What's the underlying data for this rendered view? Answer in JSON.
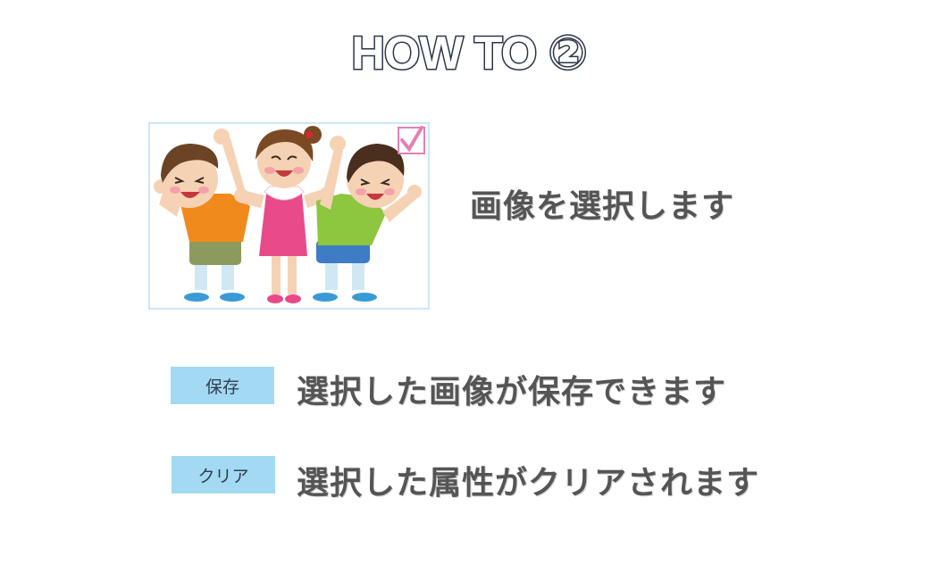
{
  "title": "HOW TO ②",
  "step_image": {
    "alt": "",
    "checked": true,
    "check_color": "#e47fb4"
  },
  "captions": {
    "select": "画像を選択します",
    "save": "選択した画像が保存できます",
    "clear": "選択した属性がクリアされます"
  },
  "buttons": {
    "save_label": "保存",
    "clear_label": "クリア",
    "color": "#a3d9f3"
  }
}
